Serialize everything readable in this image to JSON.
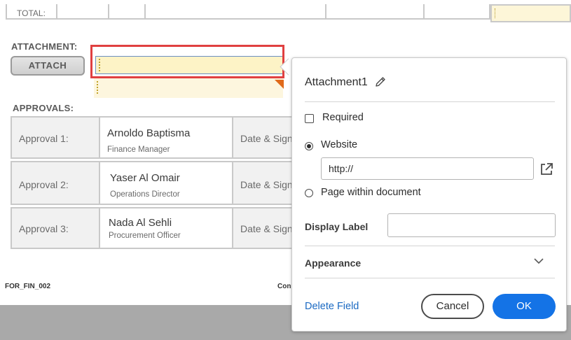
{
  "form": {
    "total_label": "TOTAL:",
    "attachment_heading": "ATTACHMENT:",
    "attach_button": "ATTACH",
    "approvals_heading": "APPROVALS:",
    "approvals": [
      {
        "label": "Approval 1:",
        "name": "Arnoldo Baptisma",
        "role": "Finance Manager",
        "date_sign": "Date & Sign"
      },
      {
        "label": "Approval 2:",
        "name": "Yaser Al Omair",
        "role": "Operations Director",
        "date_sign": "Date & Sign"
      },
      {
        "label": "Approval 3:",
        "name": "Nada Al Sehli",
        "role": "Procurement Officer",
        "date_sign": "Date & Sign"
      }
    ],
    "footer_code": "FOR_FIN_002",
    "footer_partial": "Con"
  },
  "popover": {
    "field_name": "Attachment1",
    "required_label": "Required",
    "required_checked": false,
    "website_label": "Website",
    "url_value": "http://",
    "page_within_label": "Page within document",
    "link_type_selected": "Website",
    "display_label_label": "Display Label",
    "display_label_value": "",
    "appearance_label": "Appearance",
    "delete_label": "Delete Field",
    "cancel_label": "Cancel",
    "ok_label": "OK"
  },
  "colors": {
    "accent": "#1473e6",
    "link": "#1b6ac3",
    "highlight_border": "#e04040",
    "field_fill": "#fdf3c6"
  }
}
